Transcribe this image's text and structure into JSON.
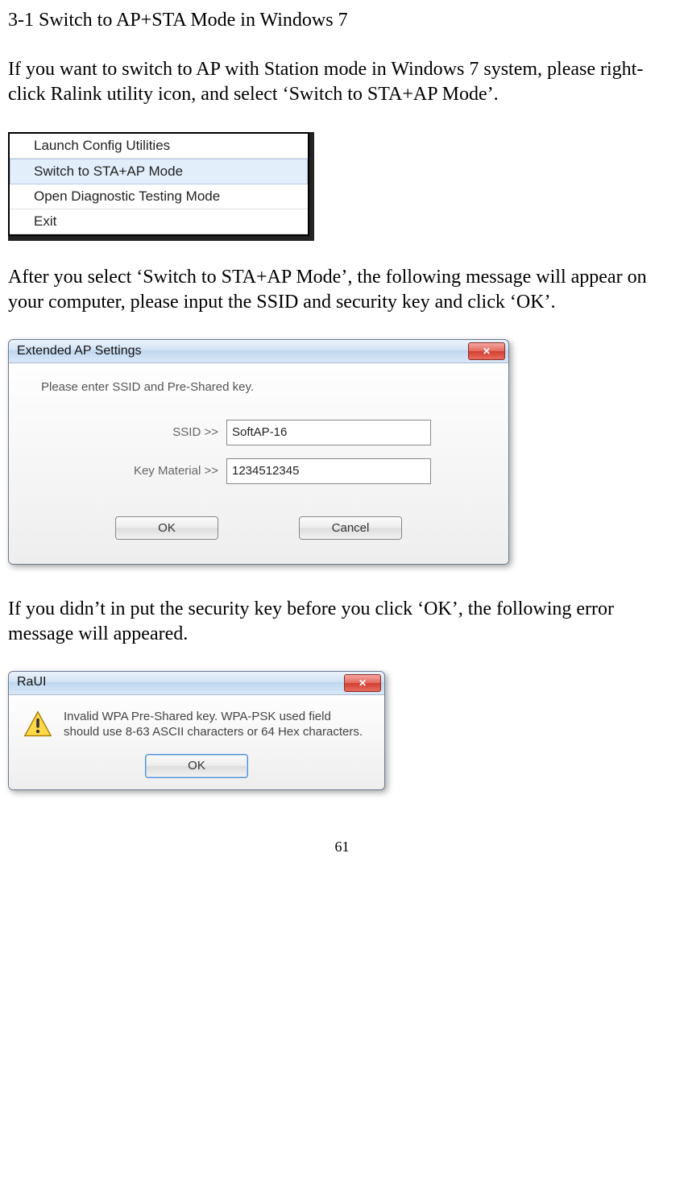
{
  "heading": "3-1 Switch to AP+STA Mode in Windows 7",
  "para1": "If you want to switch to AP with Station mode in Windows 7 system, please right-click Ralink utility icon, and select ‘Switch to STA+AP Mode’.",
  "context_menu": {
    "items": [
      "Launch Config Utilities",
      "Switch to STA+AP Mode",
      "Open Diagnostic Testing Mode",
      "Exit"
    ],
    "highlighted_index": 1
  },
  "para2": "After you select ‘Switch to STA+AP Mode’, the following message will appear on your computer, please input the SSID and security key and click ‘OK’.",
  "ap_dialog": {
    "title": "Extended AP Settings",
    "instruction": "Please enter SSID and Pre-Shared key.",
    "ssid_label": "SSID >>",
    "ssid_value": "SoftAP-16",
    "key_label": "Key Material >>",
    "key_value": "1234512345",
    "ok_label": "OK",
    "cancel_label": "Cancel"
  },
  "para3": "If you didn’t in put the security key before you click ‘OK’, the following error message will appeared.",
  "error_dialog": {
    "title": "RaUI",
    "message": "Invalid WPA Pre-Shared key. WPA-PSK used field should use 8-63 ASCII characters or 64 Hex characters.",
    "ok_label": "OK"
  },
  "page_number": "61"
}
